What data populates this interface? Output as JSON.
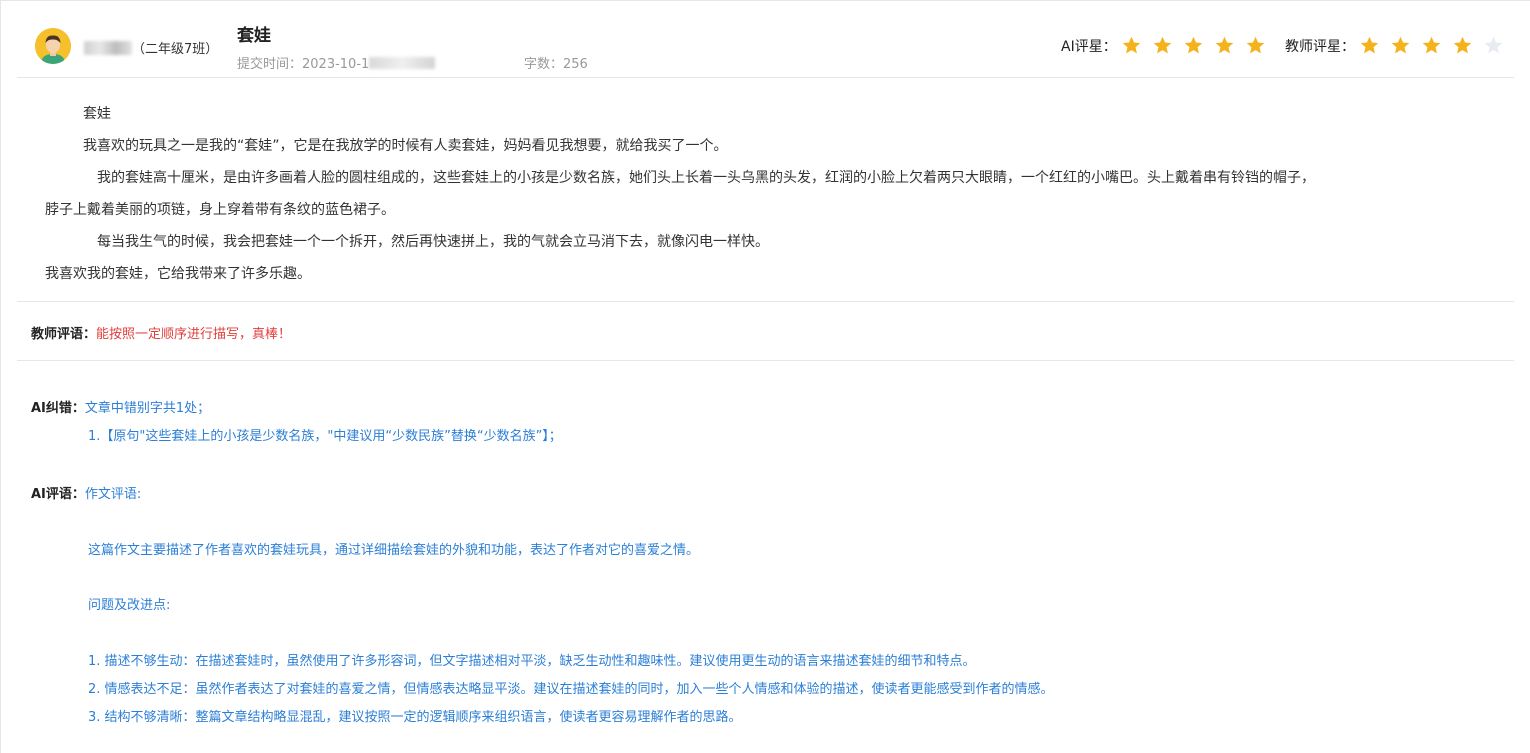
{
  "header": {
    "student_class": "（二年级7班）",
    "essay_title": "套娃",
    "submit_label": "提交时间：",
    "submit_time_visible": "2023-10-1",
    "word_count_label": "字数：",
    "word_count": "256",
    "ai_rating_label": "AI评星：",
    "ai_rating": 5,
    "teacher_rating_label": "教师评星：",
    "teacher_rating": 4,
    "rating_max": 5,
    "star_color_filled": "#f5b21b",
    "star_color_empty": "#e8ecf2"
  },
  "essay": {
    "paragraphs": [
      "套娃",
      "我喜欢的玩具之一是我的“套娃”，它是在我放学的时候有人卖套娃，妈妈看见我想要，就给我买了一个。",
      "我的套娃高十厘米，是由许多画着人脸的圆柱组成的，这些套娃上的小孩是少数名族，她们头上长着一头乌黑的头发，红润的小脸上欠着两只大眼睛，一个红红的小嘴巴。头上戴着串有铃铛的帽子，",
      "脖子上戴着美丽的项链，身上穿着带有条纹的蓝色裙子。",
      "每当我生气的时候，我会把套娃一个一个拆开，然后再快速拼上，我的气就会立马消下去，就像闪电一样快。",
      "我喜欢我的套娃，它给我带来了许多乐趣。"
    ]
  },
  "teacher_comment": {
    "label": "教师评语：",
    "text": "能按照一定顺序进行描写，真棒！"
  },
  "ai_correction": {
    "label": "AI纠错：",
    "summary": "文章中错别字共1处；",
    "items": [
      "1.【原句\"这些套娃上的小孩是少数名族，\"中建议用“少数民族”替换“少数名族”】；"
    ]
  },
  "ai_comment": {
    "label": "AI评语：",
    "heading": "作文评语:",
    "summary": "这篇作文主要描述了作者喜欢的套娃玩具，通过详细描绘套娃的外貌和功能，表达了作者对它的喜爱之情。",
    "issues_heading": "问题及改进点:",
    "issues": [
      "1. 描述不够生动：在描述套娃时，虽然使用了许多形容词，但文字描述相对平淡，缺乏生动性和趣味性。建议使用更生动的语言来描述套娃的细节和特点。",
      "2. 情感表达不足：虽然作者表达了对套娃的喜爱之情，但情感表达略显平淡。建议在描述套娃的同时，加入一些个人情感和体验的描述，使读者更能感受到作者的情感。",
      "3. 结构不够清晰：整篇文章结构略显混乱，建议按照一定的逻辑顺序来组织语言，使读者更容易理解作者的思路。"
    ]
  }
}
